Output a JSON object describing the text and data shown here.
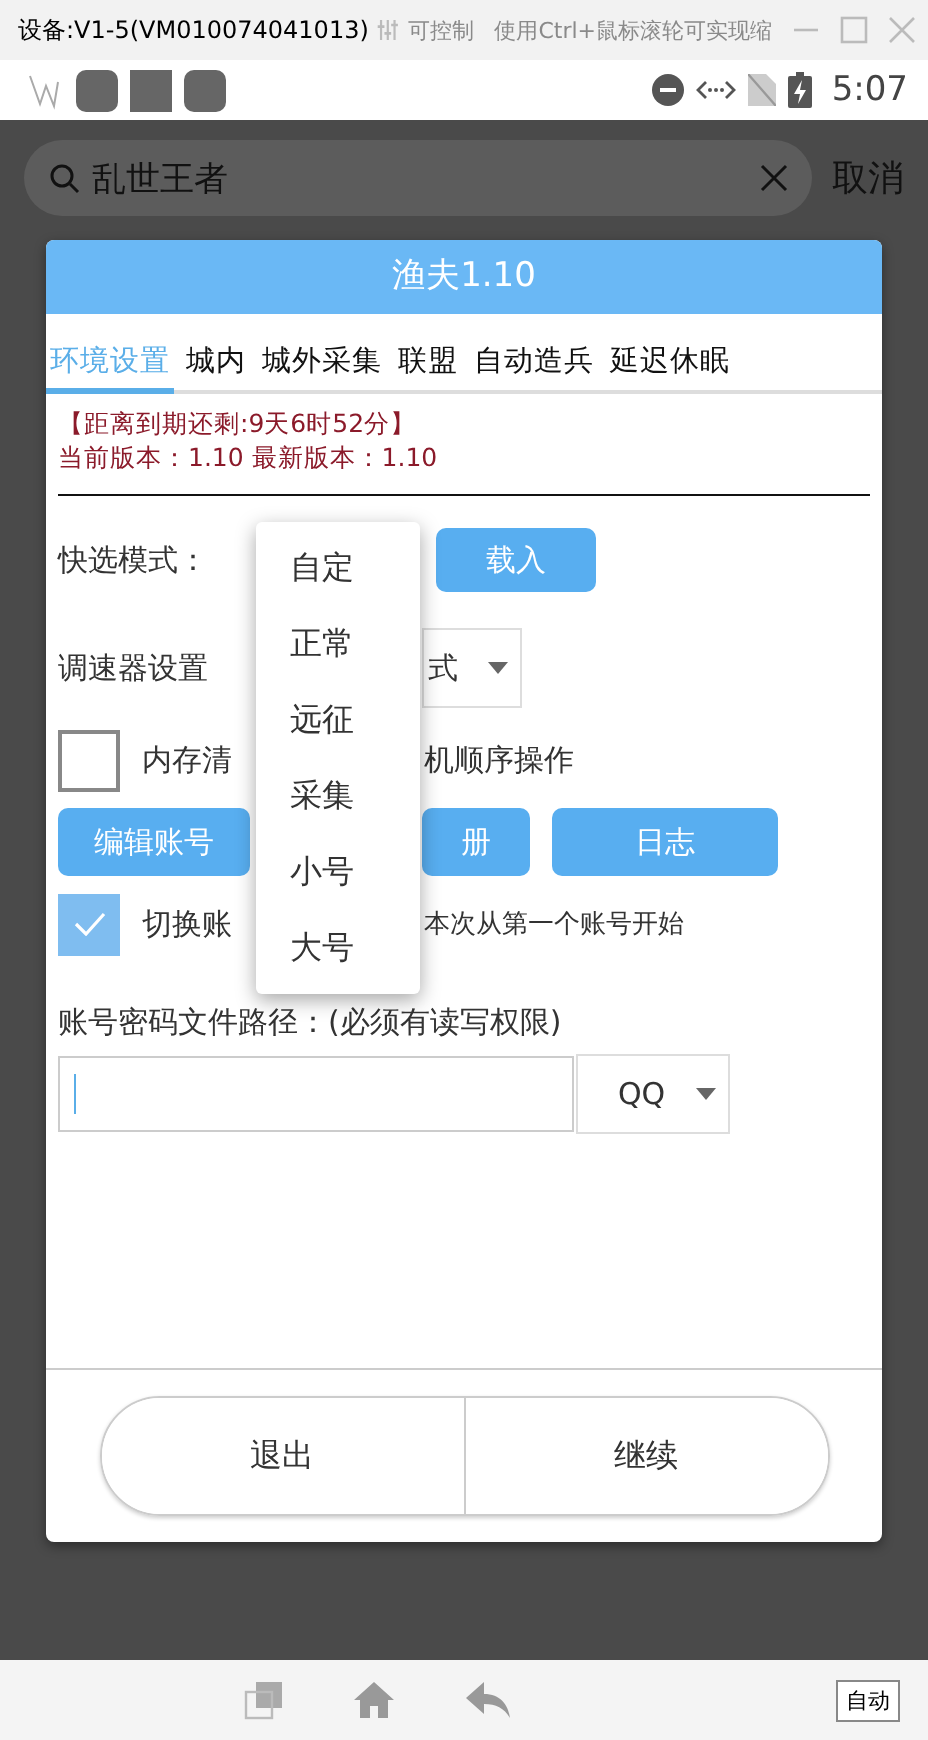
{
  "window": {
    "title": "设备:V1-5(VM010074041013)",
    "control_label": "可控制",
    "hint": "使用Ctrl+鼠标滚轮可实现缩"
  },
  "status_bar": {
    "time": "5:07"
  },
  "search": {
    "value": "乱世王者",
    "cancel": "取消"
  },
  "dialog": {
    "title": "渔夫1.10",
    "tabs": [
      {
        "label": "环境设置",
        "selected": true
      },
      {
        "label": "城内",
        "selected": false
      },
      {
        "label": "城外采集",
        "selected": false
      },
      {
        "label": "联盟",
        "selected": false
      },
      {
        "label": "自动造兵",
        "selected": false
      },
      {
        "label": "延迟休眠",
        "selected": false
      }
    ],
    "expiry": "【距离到期还剩:9天6时52分】",
    "version": "当前版本：1.10  最新版本：1.10",
    "quick_mode_label": "快选模式：",
    "load_button": "载入",
    "governor_label": "调速器设置",
    "governor_value": "式",
    "memory": {
      "checked": false,
      "text_before": "内存清",
      "text_after": "机顺序操作"
    },
    "buttons": [
      "编辑账号",
      "册",
      "日志"
    ],
    "switch": {
      "checked": true,
      "text_before": "切换账",
      "text_after": "本次从第一个账号开始"
    },
    "path_label": "账号密码文件路径：(必须有读写权限)",
    "account_type": "QQ",
    "footer_buttons": [
      "退出",
      "继续"
    ]
  },
  "dropdown": {
    "items": [
      "自定",
      "正常",
      "远征",
      "采集",
      "小号",
      "大号"
    ]
  },
  "nav_bar": {
    "auto_button": "自动"
  }
}
